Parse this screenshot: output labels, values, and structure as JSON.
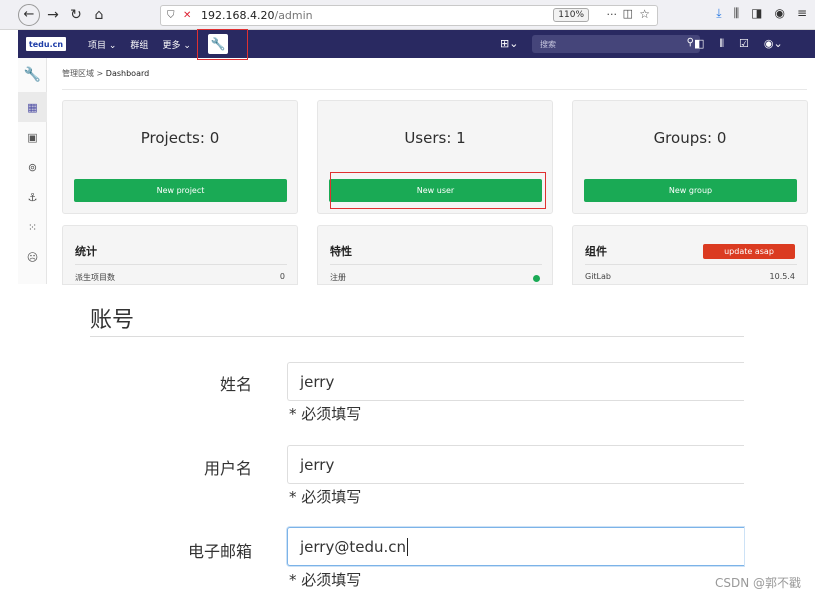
{
  "browser": {
    "address_host": "192.168.4.20",
    "address_path": "/admin",
    "zoom": "110%",
    "more_menu": "···"
  },
  "header": {
    "logo_text": "tedu.cn",
    "menu_projects": "项目",
    "menu_groups": "群组",
    "menu_more": "更多",
    "search_placeholder": "搜索"
  },
  "breadcrumb": {
    "parent": "管理区域",
    "current": "Dashboard"
  },
  "stats": [
    {
      "title": "Projects: 0",
      "button": "New project"
    },
    {
      "title": "Users: 1",
      "button": "New user"
    },
    {
      "title": "Groups: 0",
      "button": "New group"
    }
  ],
  "info": {
    "statistics": {
      "heading": "统计",
      "row_label": "派生项目数",
      "row_value": "0"
    },
    "features": {
      "heading": "特性",
      "row_label": "注册"
    },
    "components": {
      "heading": "组件",
      "badge": "update asap",
      "row_label": "GitLab",
      "row_value": "10.5.4"
    }
  },
  "form": {
    "section_title": "账号",
    "fields": [
      {
        "label": "姓名",
        "value": "jerry",
        "hint": "* 必须填写"
      },
      {
        "label": "用户名",
        "value": "jerry",
        "hint": "* 必须填写"
      },
      {
        "label": "电子邮箱",
        "value": "jerry@tedu.cn",
        "hint": "* 必须填写"
      }
    ]
  },
  "watermark": "CSDN @郭不戳",
  "colors": {
    "header_bg": "#292961",
    "success_green": "#1aaa55",
    "danger_red": "#db3b21",
    "highlight_red": "#e03030"
  }
}
